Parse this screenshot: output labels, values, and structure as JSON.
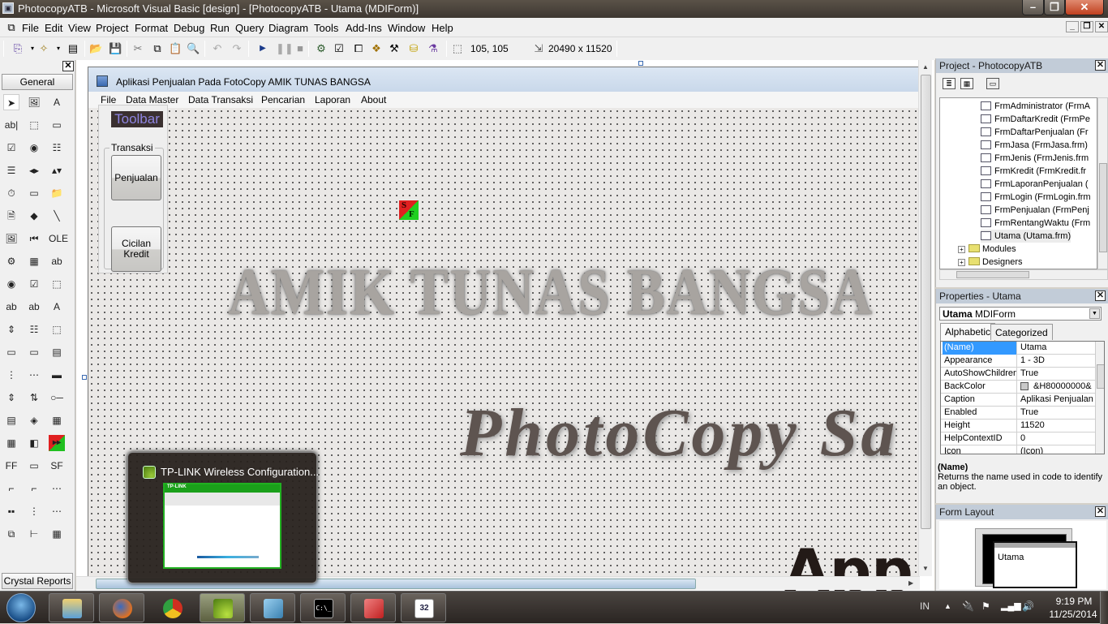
{
  "window": {
    "title": "PhotocopyATB - Microsoft Visual Basic [design] - [PhotocopyATB - Utama (MDIForm)]",
    "minimize_icon": "minimize-icon",
    "maximize_icon": "restore-icon",
    "close_icon": "close-icon"
  },
  "menubar": {
    "items": [
      {
        "label": "File",
        "accel": "F"
      },
      {
        "label": "Edit",
        "accel": "E"
      },
      {
        "label": "View",
        "accel": "V"
      },
      {
        "label": "Project",
        "accel": "P"
      },
      {
        "label": "Format",
        "accel": "o"
      },
      {
        "label": "Debug",
        "accel": "D"
      },
      {
        "label": "Run",
        "accel": "R"
      },
      {
        "label": "Query",
        "accel": "u"
      },
      {
        "label": "Diagram",
        "accel": "i"
      },
      {
        "label": "Tools",
        "accel": "T"
      },
      {
        "label": "Add-Ins",
        "accel": "A"
      },
      {
        "label": "Window",
        "accel": "W"
      },
      {
        "label": "Help",
        "accel": "H"
      }
    ],
    "mdi_buttons": [
      "_",
      "❐",
      "✕"
    ]
  },
  "toolbar": {
    "icons": [
      "add-project-icon",
      "add-form-icon",
      "menu-editor-icon",
      "open-icon",
      "save-icon",
      "cut-icon",
      "copy-icon",
      "paste-icon",
      "find-icon",
      "undo-icon",
      "redo-icon",
      "start-icon",
      "break-icon",
      "end-icon",
      "project-explorer-icon",
      "properties-window-icon",
      "form-layout-icon",
      "object-browser-icon",
      "toolbox-icon",
      "data-view-icon",
      "visual-component-manager-icon"
    ],
    "position_readout": "105, 105",
    "size_readout": "20490 x 11520"
  },
  "toolbox": {
    "tab_label": "General",
    "bottom_tab_label": "Crystal Reports",
    "tools": [
      "pointer",
      "picturebox",
      "label",
      "textbox",
      "frame",
      "commandbutton",
      "checkbox",
      "optionbutton",
      "combobox",
      "listbox",
      "hscrollbar",
      "vscrollbar",
      "timer",
      "drivelistbox",
      "dirlistbox",
      "filelistbox",
      "shape",
      "line",
      "image",
      "data",
      "ole",
      "control-a",
      "control-b",
      "control-c",
      "control-d",
      "control-e",
      "control-f",
      "control-g",
      "control-h",
      "control-i",
      "control-j",
      "control-k",
      "control-l",
      "control-m",
      "control-n",
      "control-o",
      "control-p",
      "control-q",
      "control-r",
      "control-s",
      "control-t",
      "control-u",
      "control-v",
      "control-w",
      "control-x",
      "control-y",
      "control-z",
      "sf-control",
      "control-aa",
      "control-ab",
      "control-ac",
      "control-ad",
      "control-ae",
      "control-af",
      "control-ag",
      "control-ah",
      "control-ai",
      "control-aj",
      "control-ak",
      "control-al"
    ]
  },
  "form": {
    "caption": "Aplikasi Penjualan Pada FotoCopy AMIK TUNAS BANGSA",
    "menu": [
      "File",
      "Data Master",
      "Data Transaksi",
      "Pencarian",
      "Laporan",
      "About"
    ],
    "toolbar_label": "Toolbar",
    "frame_caption": "Transaksi",
    "buttons": [
      "Penjualan",
      "Cicilan Kredit"
    ],
    "sf_icon": {
      "s": "S",
      "f": "F"
    },
    "banner_text": "AMIK TUNAS BANGSA",
    "script_text": "PhotoCopy Sa",
    "app_text": "App"
  },
  "popup": {
    "title": "TP-LINK Wireless Configuration...",
    "thumb_brand": "TP-LINK"
  },
  "project": {
    "title": "Project - PhotocopyATB",
    "items": [
      {
        "label": "FrmAdministrator (FrmA",
        "type": "form"
      },
      {
        "label": "FrmDaftarKredit (FrmPe",
        "type": "form"
      },
      {
        "label": "FrmDaftarPenjualan (Fr",
        "type": "form"
      },
      {
        "label": "FrmJasa (FrmJasa.frm)",
        "type": "form"
      },
      {
        "label": "FrmJenis (FrmJenis.frm",
        "type": "form"
      },
      {
        "label": "FrmKredit (FrmKredit.fr",
        "type": "form"
      },
      {
        "label": "FrmLaporanPenjualan (",
        "type": "form"
      },
      {
        "label": "FrmLogin (FrmLogin.frm",
        "type": "form"
      },
      {
        "label": "FrmPenjualan (FrmPenj",
        "type": "form"
      },
      {
        "label": "FrmRentangWaktu (Frm",
        "type": "form"
      },
      {
        "label": "Utama (Utama.frm)",
        "type": "mdiform"
      }
    ],
    "folders": [
      "Modules",
      "Designers"
    ]
  },
  "properties": {
    "title": "Properties - Utama",
    "object_name": "Utama",
    "object_type": "MDIForm",
    "tabs": [
      "Alphabetic",
      "Categorized"
    ],
    "rows": [
      {
        "name": "(Name)",
        "value": "Utama"
      },
      {
        "name": "Appearance",
        "value": "1 - 3D"
      },
      {
        "name": "AutoShowChildren",
        "value": "True"
      },
      {
        "name": "BackColor",
        "value": "&H80000000&"
      },
      {
        "name": "Caption",
        "value": "Aplikasi Penjualan"
      },
      {
        "name": "Enabled",
        "value": "True"
      },
      {
        "name": "Height",
        "value": "11520"
      },
      {
        "name": "HelpContextID",
        "value": "0"
      },
      {
        "name": "Icon",
        "value": "(Icon)"
      }
    ],
    "desc_name": "(Name)",
    "desc_text": "Returns the name used in code to identify an object."
  },
  "form_layout": {
    "title": "Form Layout",
    "form_label": "Utama"
  },
  "taskbar": {
    "apps": [
      "windows-explorer",
      "firefox",
      "chrome",
      "tp-link-wireless",
      "notepad",
      "command-prompt",
      "access-report",
      "vb6"
    ],
    "language": "IN",
    "time": "9:19 PM",
    "date": "11/25/2014"
  }
}
